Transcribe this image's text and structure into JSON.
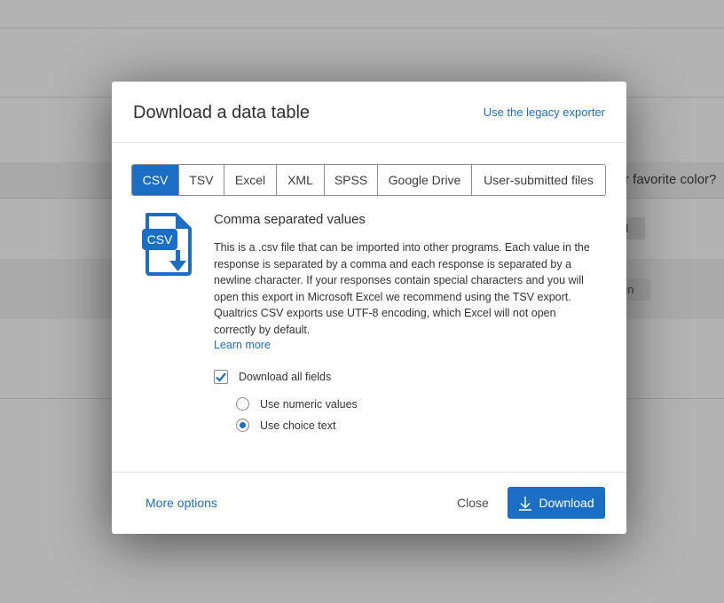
{
  "background": {
    "question_text": "r favorite color?",
    "pill_1": "d",
    "pill_2": "en"
  },
  "modal": {
    "title": "Download a data table",
    "legacy_link": "Use the legacy exporter",
    "tabs": [
      {
        "label": "CSV",
        "active": true
      },
      {
        "label": "TSV",
        "active": false
      },
      {
        "label": "Excel",
        "active": false
      },
      {
        "label": "XML",
        "active": false
      },
      {
        "label": "SPSS",
        "active": false
      },
      {
        "label": "Google Drive",
        "active": false
      },
      {
        "label": "User-submitted files",
        "active": false
      }
    ],
    "file_icon_label": "CSV",
    "format_title": "Comma separated values",
    "format_description": "This is a .csv file that can be imported into other programs. Each value in the response is separated by a comma and each response is separated by a newline character. If your responses contain special characters and you will open this export in Microsoft Excel we recommend using the TSV export. Qualtrics CSV exports use UTF-8 encoding, which Excel will not open correctly by default.",
    "learn_more": "Learn more",
    "download_all_fields": {
      "label": "Download all fields",
      "checked": true
    },
    "value_options": [
      {
        "label": "Use numeric values",
        "selected": false
      },
      {
        "label": "Use choice text",
        "selected": true
      }
    ],
    "footer": {
      "more_options": "More options",
      "close": "Close",
      "download": "Download"
    }
  },
  "colors": {
    "accent": "#1a6fc4",
    "overlay": "#b3b3b3"
  }
}
